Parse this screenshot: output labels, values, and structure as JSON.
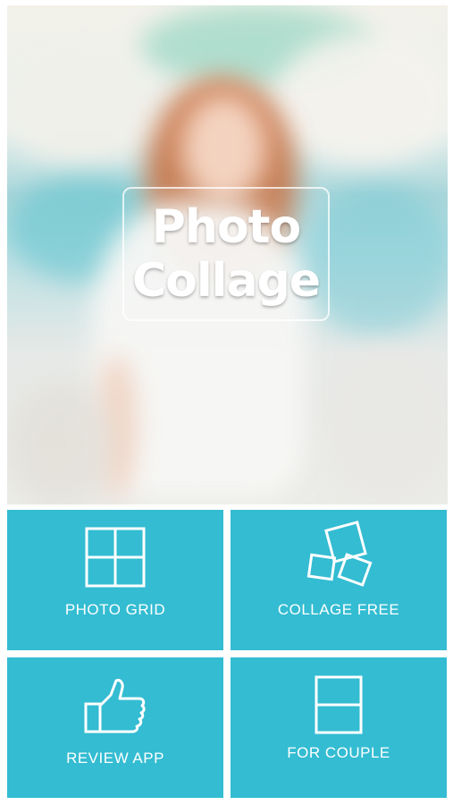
{
  "hero": {
    "title_line1": "Photo",
    "title_line2": "Collage"
  },
  "menu": {
    "items": [
      {
        "label": "PHOTO GRID",
        "icon": "grid-icon"
      },
      {
        "label": "COLLAGE FREE",
        "icon": "scattered-frames-icon"
      },
      {
        "label": "REVIEW APP",
        "icon": "thumbs-up-icon"
      },
      {
        "label": "FOR COUPLE",
        "icon": "split-frame-icon"
      }
    ]
  },
  "colors": {
    "tile": "#33bcd2",
    "text": "#ffffff"
  }
}
